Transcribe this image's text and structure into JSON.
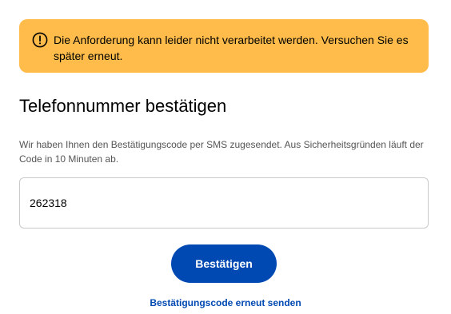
{
  "alert": {
    "icon": "exclamation-circle-icon",
    "message": "Die Anforderung kann leider nicht verarbeitet werden. Versuchen Sie es später erneut.",
    "background_color": "#ffbc4b"
  },
  "heading": {
    "title": "Telefonnummer bestätigen"
  },
  "description": "Wir haben Ihnen den Bestätigungscode per SMS zugesendet. Aus Sicherheitsgründen läuft der Code in 10 Minuten ab.",
  "code_input": {
    "value": "262318"
  },
  "confirm_button": {
    "label": "Bestätigen",
    "color": "#0049b2"
  },
  "resend_link": {
    "label": "Bestätigungscode erneut senden"
  }
}
